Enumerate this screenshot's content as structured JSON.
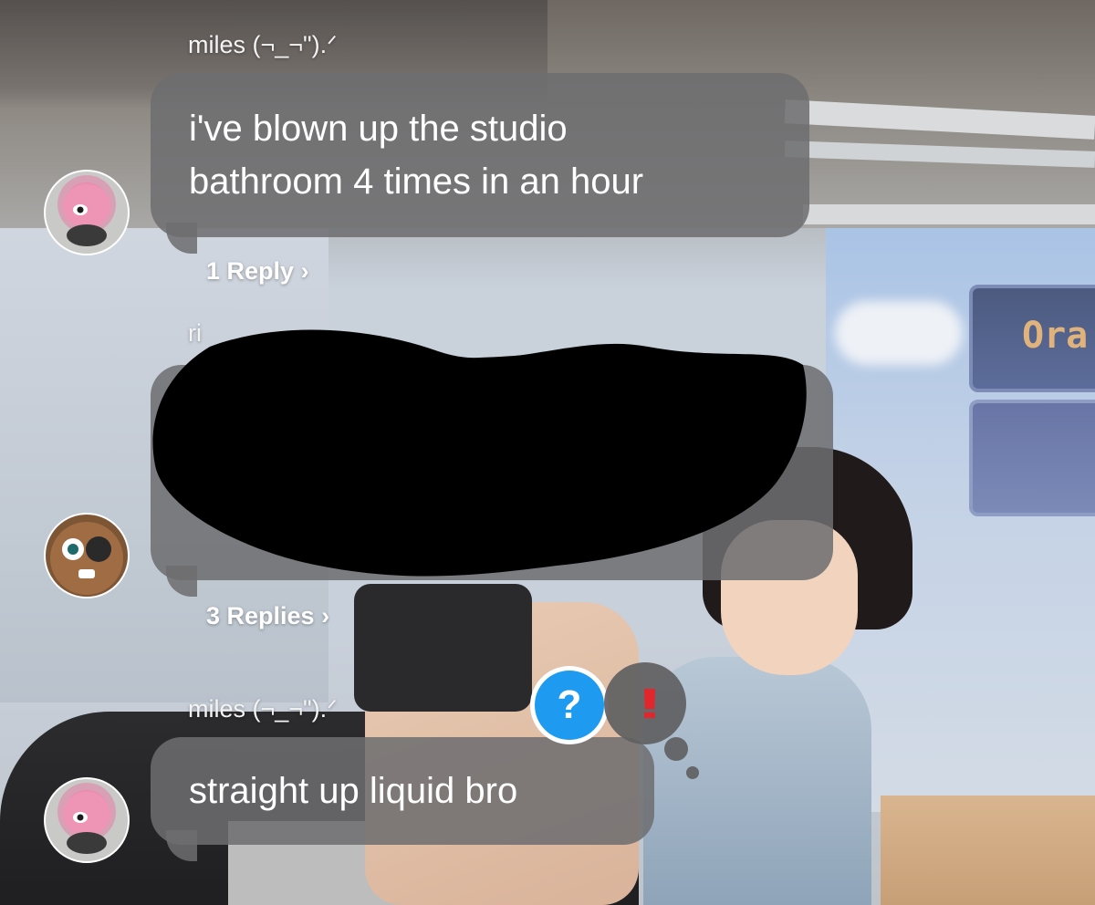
{
  "messages": [
    {
      "sender": "miles (¬_¬\").ᐟ",
      "text_line1": "i've blown up the studio",
      "text_line2": "bathroom 4 times in an hour",
      "reply_link": "1 Reply"
    },
    {
      "sender": "ri",
      "redacted": true,
      "reply_link": "3 Replies"
    },
    {
      "sender": "miles (¬_¬\").ᐟ",
      "text": "straight up liquid bro",
      "reactions": [
        {
          "icon": "question-mark-icon",
          "glyph": "?",
          "color": "#1e9bf0"
        },
        {
          "icon": "double-exclamation-icon",
          "glyph": "!!",
          "color": "#e2262b"
        }
      ]
    }
  ],
  "background": {
    "sign_text": "Ora"
  },
  "colors": {
    "bubble": "#6e6e70",
    "text": "#ffffff",
    "reaction_blue": "#1e9bf0",
    "reaction_red": "#e2262b"
  }
}
